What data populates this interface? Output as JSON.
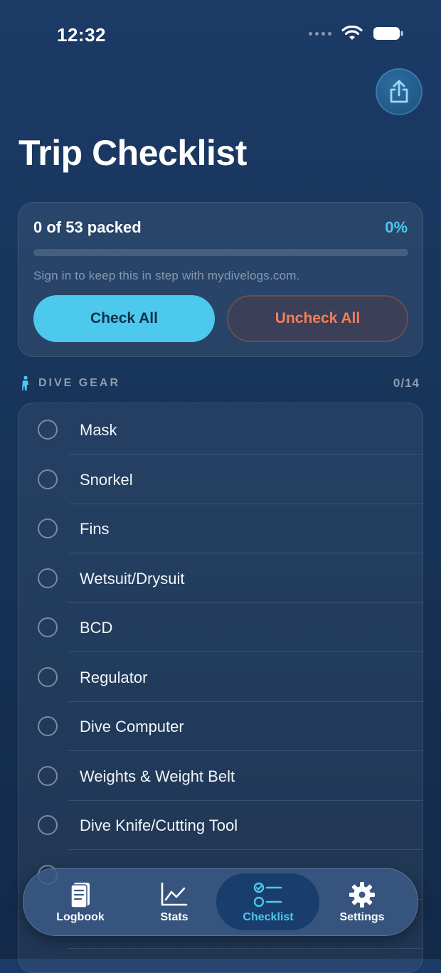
{
  "status": {
    "time": "12:32"
  },
  "header": {
    "title": "Trip Checklist",
    "share_icon": "share-icon"
  },
  "summary": {
    "packed_text": "0 of 53 packed",
    "percent_text": "0%",
    "progress": 0,
    "sync_note": "Sign in to keep this in step with mydivelogs.com.",
    "check_all_label": "Check All",
    "uncheck_all_label": "Uncheck All"
  },
  "section": {
    "icon": "diver-icon",
    "title": "DIVE GEAR",
    "count": "0/14"
  },
  "items": [
    {
      "label": "Mask",
      "checked": false
    },
    {
      "label": "Snorkel",
      "checked": false
    },
    {
      "label": "Fins",
      "checked": false
    },
    {
      "label": "Wetsuit/Drysuit",
      "checked": false
    },
    {
      "label": "BCD",
      "checked": false
    },
    {
      "label": "Regulator",
      "checked": false
    },
    {
      "label": "Dive Computer",
      "checked": false
    },
    {
      "label": "Weights & Weight Belt",
      "checked": false
    },
    {
      "label": "Dive Knife/Cutting Tool",
      "checked": false
    }
  ],
  "tabs": [
    {
      "label": "Logbook",
      "icon": "logbook-icon"
    },
    {
      "label": "Stats",
      "icon": "stats-icon"
    },
    {
      "label": "Checklist",
      "icon": "checklist-icon",
      "active": true
    },
    {
      "label": "Settings",
      "icon": "gear-icon"
    }
  ],
  "colors": {
    "accent": "#4cc9ec",
    "uncheck": "#f0805b",
    "background": "#173459"
  }
}
